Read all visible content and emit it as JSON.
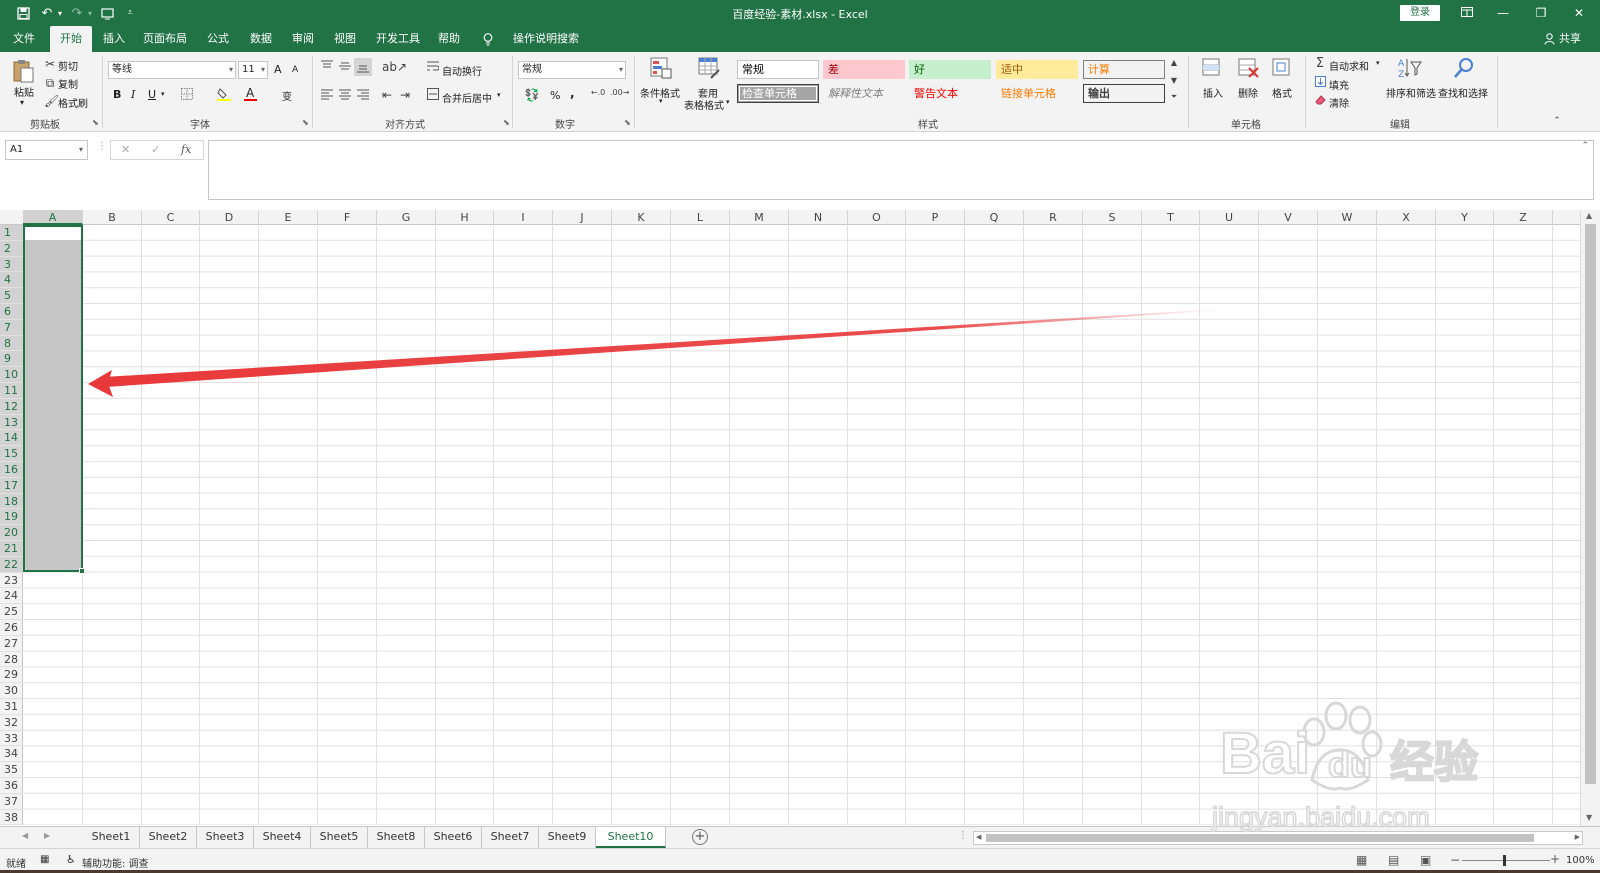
{
  "window": {
    "title": "百度经验-素材.xlsx  -  Excel",
    "login_label": "登录",
    "share_label": "共享",
    "qat_icons": [
      "save-icon",
      "undo-icon",
      "redo-icon",
      "touch-mode-icon",
      "customize-icon"
    ]
  },
  "ribbon_tabs": [
    "文件",
    "开始",
    "插入",
    "页面布局",
    "公式",
    "数据",
    "审阅",
    "视图",
    "开发工具",
    "帮助",
    "操作说明搜索"
  ],
  "active_tab": "开始",
  "clipboard": {
    "paste": "粘贴",
    "cut": "剪切",
    "copy": "复制",
    "format_painter": "格式刷",
    "group": "剪贴板"
  },
  "font": {
    "name": "等线",
    "size": "11",
    "bold": "B",
    "italic": "I",
    "underline": "U",
    "grow": "A",
    "shrink": "A",
    "color_letter": "A",
    "phonetic": "变",
    "group": "字体"
  },
  "alignment": {
    "wrap": "自动换行",
    "merge": "合并后居中",
    "group": "对齐方式"
  },
  "number": {
    "format": "常规",
    "percent": "%",
    "comma": ",",
    "group": "数字"
  },
  "styles": {
    "conditional": "条件格式",
    "table_line1": "套用",
    "table_line2": "表格格式",
    "cells": [
      {
        "label": "常规",
        "bg": "#ffffff",
        "fg": "#000000",
        "border": "#c6c6c6"
      },
      {
        "label": "差",
        "bg": "#ffc7ce",
        "fg": "#9c0006",
        "border": "#ffc7ce"
      },
      {
        "label": "好",
        "bg": "#c6efce",
        "fg": "#006100",
        "border": "#c6efce"
      },
      {
        "label": "适中",
        "bg": "#ffeb9c",
        "fg": "#9c5700",
        "border": "#ffeb9c"
      },
      {
        "label": "计算",
        "bg": "#f2f2f2",
        "fg": "#fa7d00",
        "border": "#7f7f7f"
      },
      {
        "label": "检查单元格",
        "bg": "#a5a5a5",
        "fg": "#ffffff",
        "border": "#3f3f3f"
      },
      {
        "label": "解释性文本",
        "bg": "#f3f3f3",
        "fg": "#7f7f7f",
        "border": "#f3f3f3"
      },
      {
        "label": "警告文本",
        "bg": "#f3f3f3",
        "fg": "#ff0000",
        "border": "#f3f3f3"
      },
      {
        "label": "链接单元格",
        "bg": "#f3f3f3",
        "fg": "#fa7d00",
        "border": "#f3f3f3"
      },
      {
        "label": "输出",
        "bg": "#f2f2f2",
        "fg": "#3f3f3f",
        "border": "#3f3f3f"
      }
    ],
    "group": "样式"
  },
  "cells_group": {
    "insert": "插入",
    "delete": "删除",
    "format": "格式",
    "group": "单元格"
  },
  "editing": {
    "autosum": "自动求和",
    "fill": "填充",
    "clear": "清除",
    "sort": "排序和筛选",
    "find": "查找和选择",
    "group": "编辑"
  },
  "formula_bar": {
    "name_box": "A1",
    "fx": "fx",
    "content": ""
  },
  "grid": {
    "columns": [
      "A",
      "B",
      "C",
      "D",
      "E",
      "F",
      "G",
      "H",
      "I",
      "J",
      "K",
      "L",
      "M",
      "N",
      "O",
      "P",
      "Q",
      "R",
      "S",
      "T",
      "U",
      "V",
      "W",
      "X",
      "Y",
      "Z"
    ],
    "rows": [
      "1",
      "2",
      "3",
      "4",
      "5",
      "6",
      "7",
      "8",
      "9",
      "10",
      "11",
      "12",
      "13",
      "14",
      "15",
      "16",
      "17",
      "18",
      "19",
      "20",
      "21",
      "22",
      "23",
      "24",
      "25",
      "26",
      "27",
      "28",
      "29",
      "30",
      "31",
      "32",
      "33",
      "34",
      "35",
      "36",
      "37",
      "38"
    ],
    "selected_column": "A",
    "selected_rows": "1-22"
  },
  "sheets": [
    "Sheet1",
    "Sheet2",
    "Sheet3",
    "Sheet4",
    "Sheet5",
    "Sheet8",
    "Sheet6",
    "Sheet7",
    "Sheet9",
    "Sheet10"
  ],
  "active_sheet": "Sheet10",
  "status": {
    "ready": "就绪",
    "accessibility": "辅助功能: 调查",
    "zoom": "100%"
  },
  "watermark": {
    "brand": "Bai",
    "brand_tail": "du",
    "brand_cn": "经验",
    "url": "jingyan.baidu.com"
  },
  "colors": {
    "excel_green": "#217346",
    "arrow_red": "#e8393a"
  }
}
